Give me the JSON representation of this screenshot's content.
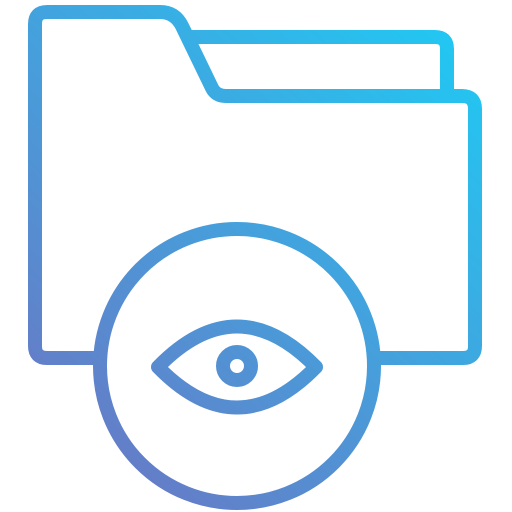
{
  "icon": {
    "name": "folder-view-icon",
    "parts": [
      "folder-icon",
      "eye-icon"
    ],
    "style": "outline",
    "gradient": {
      "start": "#6a77c4",
      "end": "#1fcaf4"
    },
    "background": "#ffffff"
  }
}
